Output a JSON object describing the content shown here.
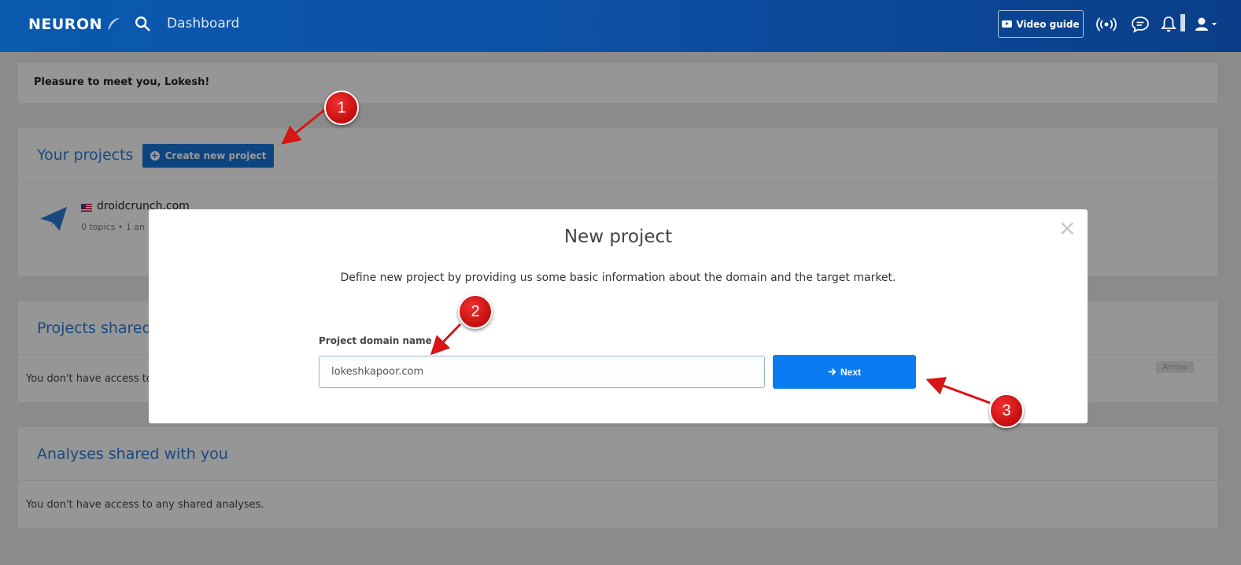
{
  "header": {
    "logo_text": "NEURON",
    "page_title": "Dashboard",
    "video_guide_label": "Video guide",
    "icons": [
      "search-icon",
      "broadcast-icon",
      "chat-icon",
      "bell-icon",
      "user-icon"
    ]
  },
  "greeting": "Pleasure to meet you, Lokesh!",
  "projects": {
    "title": "Your projects",
    "create_label": "Create new project",
    "items": [
      {
        "name": "droidcrunch.com",
        "meta": "0 topics  •  1 an"
      }
    ]
  },
  "shared_projects": {
    "title": "Projects shared",
    "message": "You don't have access to",
    "tag": "Arrow"
  },
  "shared_analyses": {
    "title": "Analyses shared with you",
    "message": "You don't have access to any shared analyses."
  },
  "modal": {
    "title": "New project",
    "description": "Define new project by providing us some basic information about the domain and the target market.",
    "field_label": "Project domain name",
    "field_value": "lokeshkapoor.com",
    "next_label": "Next",
    "close_symbol": "×"
  },
  "annotations": [
    "1",
    "2",
    "3"
  ],
  "colors": {
    "header": "#0d4fa3",
    "primary_button": "#0b7bf2",
    "link_blue": "#2c7bd6",
    "annotation_red": "#d81414"
  }
}
